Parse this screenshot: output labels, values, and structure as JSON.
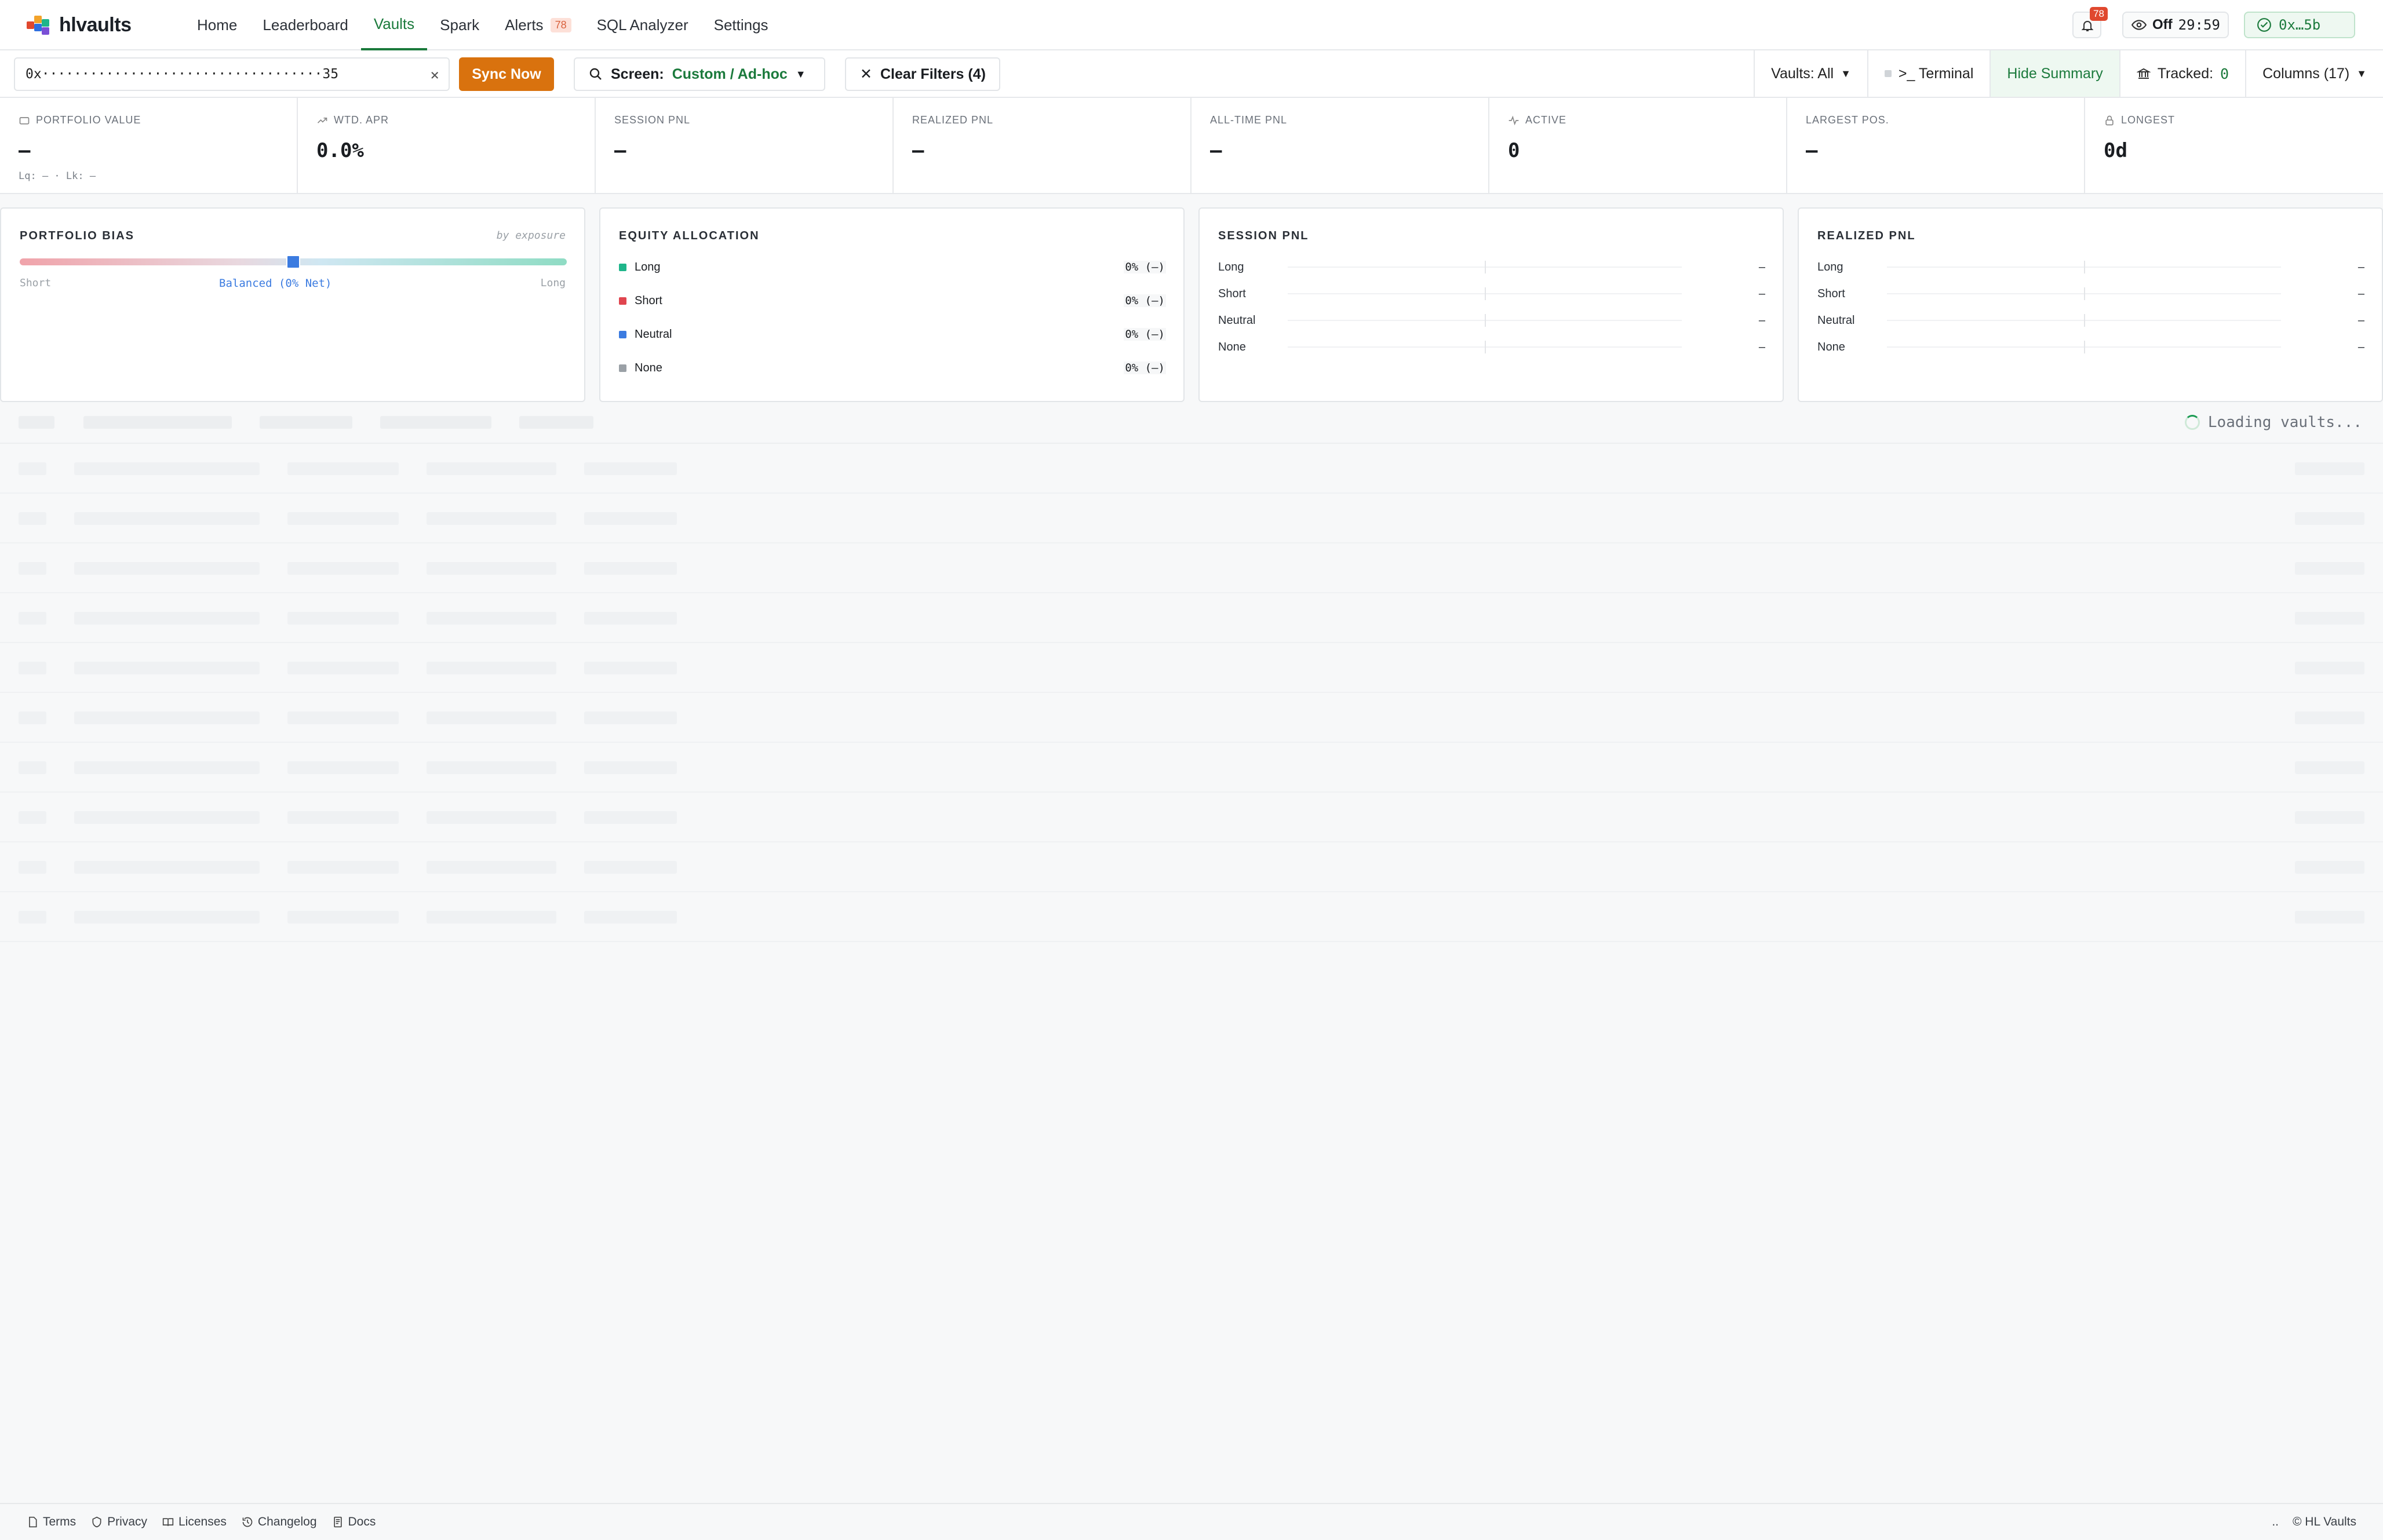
{
  "app": {
    "name": "hlvaults"
  },
  "nav": {
    "items": [
      {
        "label": "Home"
      },
      {
        "label": "Leaderboard"
      },
      {
        "label": "Vaults",
        "active": true
      },
      {
        "label": "Spark"
      },
      {
        "label": "Alerts",
        "badge": "78"
      },
      {
        "label": "SQL Analyzer"
      },
      {
        "label": "Settings"
      }
    ],
    "notifications_badge": "78",
    "watch": {
      "state": "Off",
      "timer": "29:59"
    },
    "wallet": "0x…5b"
  },
  "toolbar": {
    "address_value": "0x···································35",
    "sync_label": "Sync Now",
    "screen_label": "Screen:",
    "screen_value": "Custom / Ad-hoc",
    "clear_filters": "Clear Filters (4)",
    "vaults_filter": "Vaults: All",
    "terminal": ">_ Terminal",
    "hide_summary": "Hide Summary",
    "tracked_label": "Tracked:",
    "tracked_value": "0",
    "columns": "Columns (17)"
  },
  "stats": [
    {
      "label": "PORTFOLIO VALUE",
      "value": "–",
      "sub": "Lq: – · Lk: –",
      "icon": "wallet-icon"
    },
    {
      "label": "WTD. APR",
      "value": "0.0%",
      "icon": "trend-icon"
    },
    {
      "label": "SESSION PNL",
      "value": "—"
    },
    {
      "label": "REALIZED PNL",
      "value": "—"
    },
    {
      "label": "ALL-TIME PNL",
      "value": "—"
    },
    {
      "label": "ACTIVE",
      "value": "0",
      "icon": "pulse-icon"
    },
    {
      "label": "LARGEST POS.",
      "value": "–"
    },
    {
      "label": "LONGEST",
      "value": "0d",
      "icon": "lock-icon"
    }
  ],
  "bias": {
    "title": "PORTFOLIO BIAS",
    "subtitle": "by exposure",
    "left": "Short",
    "right": "Long",
    "center": "Balanced (0% Net)",
    "net_fraction": 0.5
  },
  "equity": {
    "title": "EQUITY ALLOCATION",
    "rows": [
      {
        "label": "Long",
        "value": "0% (–)",
        "color": "#1fb58a"
      },
      {
        "label": "Short",
        "value": "0% (–)",
        "color": "#e0454f"
      },
      {
        "label": "Neutral",
        "value": "0% (–)",
        "color": "#3b7be0"
      },
      {
        "label": "None",
        "value": "0% (–)",
        "color": "#9aa0a6"
      }
    ]
  },
  "session_pnl": {
    "title": "SESSION PNL",
    "rows": [
      {
        "label": "Long",
        "value": "–"
      },
      {
        "label": "Short",
        "value": "–"
      },
      {
        "label": "Neutral",
        "value": "–"
      },
      {
        "label": "None",
        "value": "–"
      }
    ]
  },
  "realized_pnl": {
    "title": "REALIZED PNL",
    "rows": [
      {
        "label": "Long",
        "value": "–"
      },
      {
        "label": "Short",
        "value": "–"
      },
      {
        "label": "Neutral",
        "value": "–"
      },
      {
        "label": "None",
        "value": "–"
      }
    ]
  },
  "table": {
    "loading": "Loading vaults..."
  },
  "footer": {
    "links": [
      {
        "label": "Terms"
      },
      {
        "label": "Privacy"
      },
      {
        "label": "Licenses"
      },
      {
        "label": "Changelog"
      },
      {
        "label": "Docs"
      }
    ],
    "ellipsis": "..",
    "copyright": "© HL Vaults"
  },
  "colors": {
    "accent": "#1b7a3c",
    "sync": "#d9720e",
    "alert": "#e0482e"
  }
}
